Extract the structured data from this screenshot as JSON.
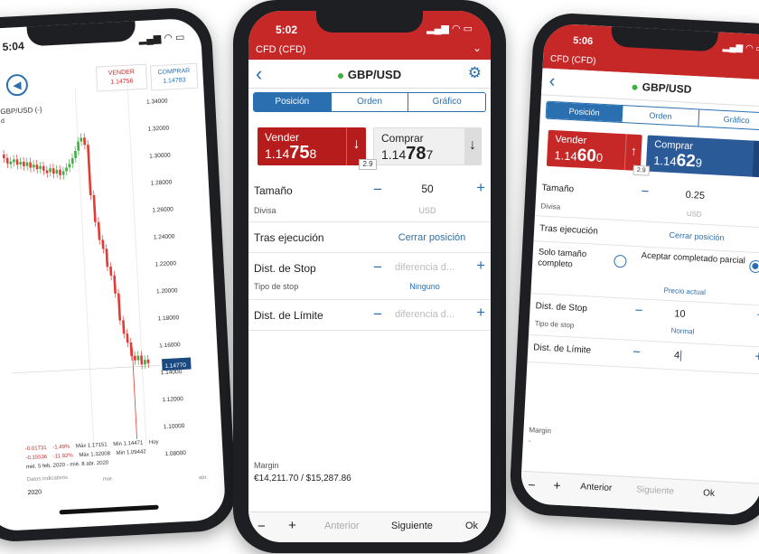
{
  "left": {
    "status_time": "5:04",
    "sell_label": "VENDER",
    "sell_price": "1.14756",
    "buy_label": "COMPRAR",
    "buy_price": "1.14783",
    "pair": "GBP/USD (-)",
    "pair_sub": "d",
    "y_ticks": [
      "1.34000",
      "1.32000",
      "1.30000",
      "1.28000",
      "1.26000",
      "1.24000",
      "1.22000",
      "1.20000",
      "1.18000",
      "1.16000",
      "1.14000",
      "1.12000",
      "1.10000",
      "1.08000"
    ],
    "current_price": "1.14770",
    "stats": {
      "row1": [
        "-0.01731",
        "-1.49%",
        "Máx 1.17151",
        "Min 1.14471",
        "Hoy"
      ],
      "row2": [
        "-0.15536",
        "-11.92%",
        "Máx 1.32008",
        "Min 1.09442"
      ],
      "range": "mié. 5 feb. 2020 - mié. 8 abr. 2020"
    },
    "footer_left": "Datos indicativos",
    "footer_mid": "mar.",
    "footer_right": "abr.",
    "year": "2020"
  },
  "mid": {
    "status_time": "5:02",
    "account": "CFD (CFD)",
    "pair": "GBP/USD",
    "tabs": [
      "Posición",
      "Orden",
      "Gráfico"
    ],
    "sell": {
      "label": "Vender",
      "pre": "1.14",
      "big": "75",
      "post": "8"
    },
    "buy": {
      "label": "Comprar",
      "pre": "1.14",
      "big": "78",
      "post": "7"
    },
    "spread": "2.9",
    "size_label": "Tamaño",
    "size_value": "50",
    "currency_label": "Divisa",
    "currency_value": "USD",
    "after_exec_label": "Tras ejecución",
    "after_exec_value": "Cerrar posición",
    "stop_label": "Dist. de Stop",
    "stop_placeholder": "diferencia d...",
    "stop_type_label": "Tipo de stop",
    "stop_type_value": "Ninguno",
    "limit_label": "Dist. de Límite",
    "limit_placeholder": "diferencia d...",
    "margin_label": "Margin",
    "margin_value": "€14,211.70 / $15,287.86",
    "toolbar": {
      "minus": "−",
      "plus": "+",
      "prev": "Anterior",
      "next": "Siguiente",
      "ok": "Ok"
    }
  },
  "right": {
    "status_time": "5:06",
    "account": "CFD (CFD)",
    "pair": "GBP/USD",
    "tabs": [
      "Posición",
      "Orden",
      "Gráfico"
    ],
    "sell": {
      "label": "Vender",
      "pre": "1.14",
      "big": "60",
      "post": "0"
    },
    "buy": {
      "label": "Comprar",
      "pre": "1.14",
      "big": "62",
      "post": "9"
    },
    "spread": "2.9",
    "size_label": "Tamaño",
    "size_value": "0.25",
    "currency_label": "Divisa",
    "currency_value": "USD",
    "after_exec_label": "Tras ejecución",
    "after_exec_value": "Cerrar posición",
    "fill_option_1": "Solo tamaño completo",
    "fill_option_2": "Aceptar completado parcial",
    "price_current": "Precio actual",
    "stop_label": "Dist. de Stop",
    "stop_value": "10",
    "stop_type_label": "Tipo de stop",
    "stop_type_value": "Normal",
    "limit_label": "Dist. de Límite",
    "limit_value": "4",
    "margin_label": "Margin",
    "margin_value": "-",
    "toolbar": {
      "minus": "−",
      "plus": "+",
      "prev": "Anterior",
      "next": "Siguiente",
      "ok": "Ok"
    }
  },
  "colors": {
    "brand_red": "#c62828",
    "accent_blue": "#2a6fb0",
    "up_green": "#3cb043"
  }
}
